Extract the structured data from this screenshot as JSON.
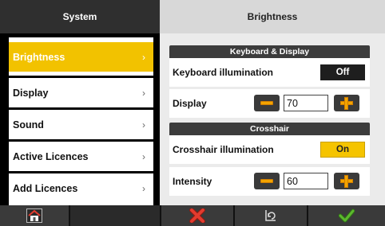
{
  "left_panel": {
    "title": "System",
    "items": [
      {
        "label": "Brightness",
        "chevron": "›",
        "active": true
      },
      {
        "label": "Display",
        "chevron": "›",
        "active": false
      },
      {
        "label": "Sound",
        "chevron": "›",
        "active": false
      },
      {
        "label": "Active Licences",
        "chevron": "›",
        "active": false
      },
      {
        "label": "Add Licences",
        "chevron": "›",
        "active": false
      }
    ]
  },
  "right_panel": {
    "title": "Brightness",
    "sections": [
      {
        "title": "Keyboard & Display",
        "rows": [
          {
            "label": "Keyboard illumination",
            "toggle": "Off"
          },
          {
            "label": "Display",
            "value": "70"
          }
        ]
      },
      {
        "title": "Crosshair",
        "rows": [
          {
            "label": "Crosshair illumination",
            "toggle": "On"
          },
          {
            "label": "Intensity",
            "value": "60"
          }
        ]
      }
    ]
  },
  "bottom_bar": {
    "buttons": [
      "home-icon",
      "cancel-x-icon",
      "back-return-icon",
      "confirm-check-icon"
    ]
  },
  "colors": {
    "accent": "#f2c200",
    "stepper_orange": "#f3a400",
    "cancel_red": "#e23b2e",
    "confirm_green": "#5cb82e"
  }
}
